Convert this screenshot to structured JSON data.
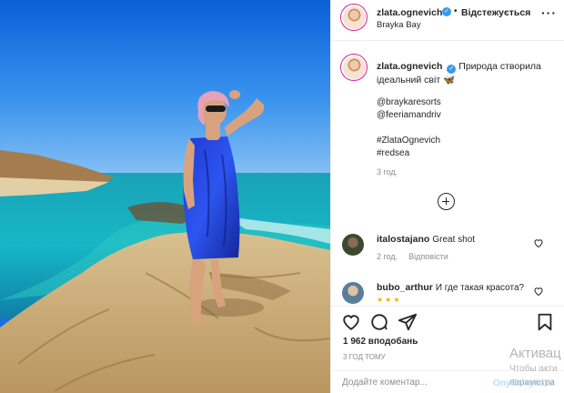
{
  "post": {
    "username": "zlata.ogneVich",
    "following_label": "Відстежується",
    "location": "Brayka Bay",
    "caption": {
      "username": "zlata.ognevich",
      "text": "Природа створила ідеальний світ 🦋",
      "lines": [
        "@braykaresorts",
        "@feeriamandriv",
        "",
        "#ZlataOgnevich",
        "#redsea"
      ],
      "time": "3 год."
    }
  },
  "comments": [
    {
      "username": "italostajano",
      "text": "Great shot",
      "time": "2 год.",
      "reply_label": "Відповісти"
    },
    {
      "username": "bubo_arthur",
      "text": "И где такая красота?",
      "stars": "★★★"
    }
  ],
  "actions": {
    "likes": "1 962 вподобань",
    "posted": "3 год тому"
  },
  "add_comment": {
    "placeholder": "Додайте коментар...",
    "publish_label": "Опублікувати"
  },
  "watermark": {
    "title": "Активац",
    "line1": "Чтобы акти",
    "line2": "параметра"
  },
  "icons": [
    "verified-icon",
    "more-icon",
    "plus-circle-icon",
    "heart-icon",
    "comment-icon",
    "share-icon",
    "bookmark-icon"
  ],
  "colors": {
    "verified": "#3897f0",
    "publish": "#b2dffc",
    "muted": "#8e8e8e"
  }
}
